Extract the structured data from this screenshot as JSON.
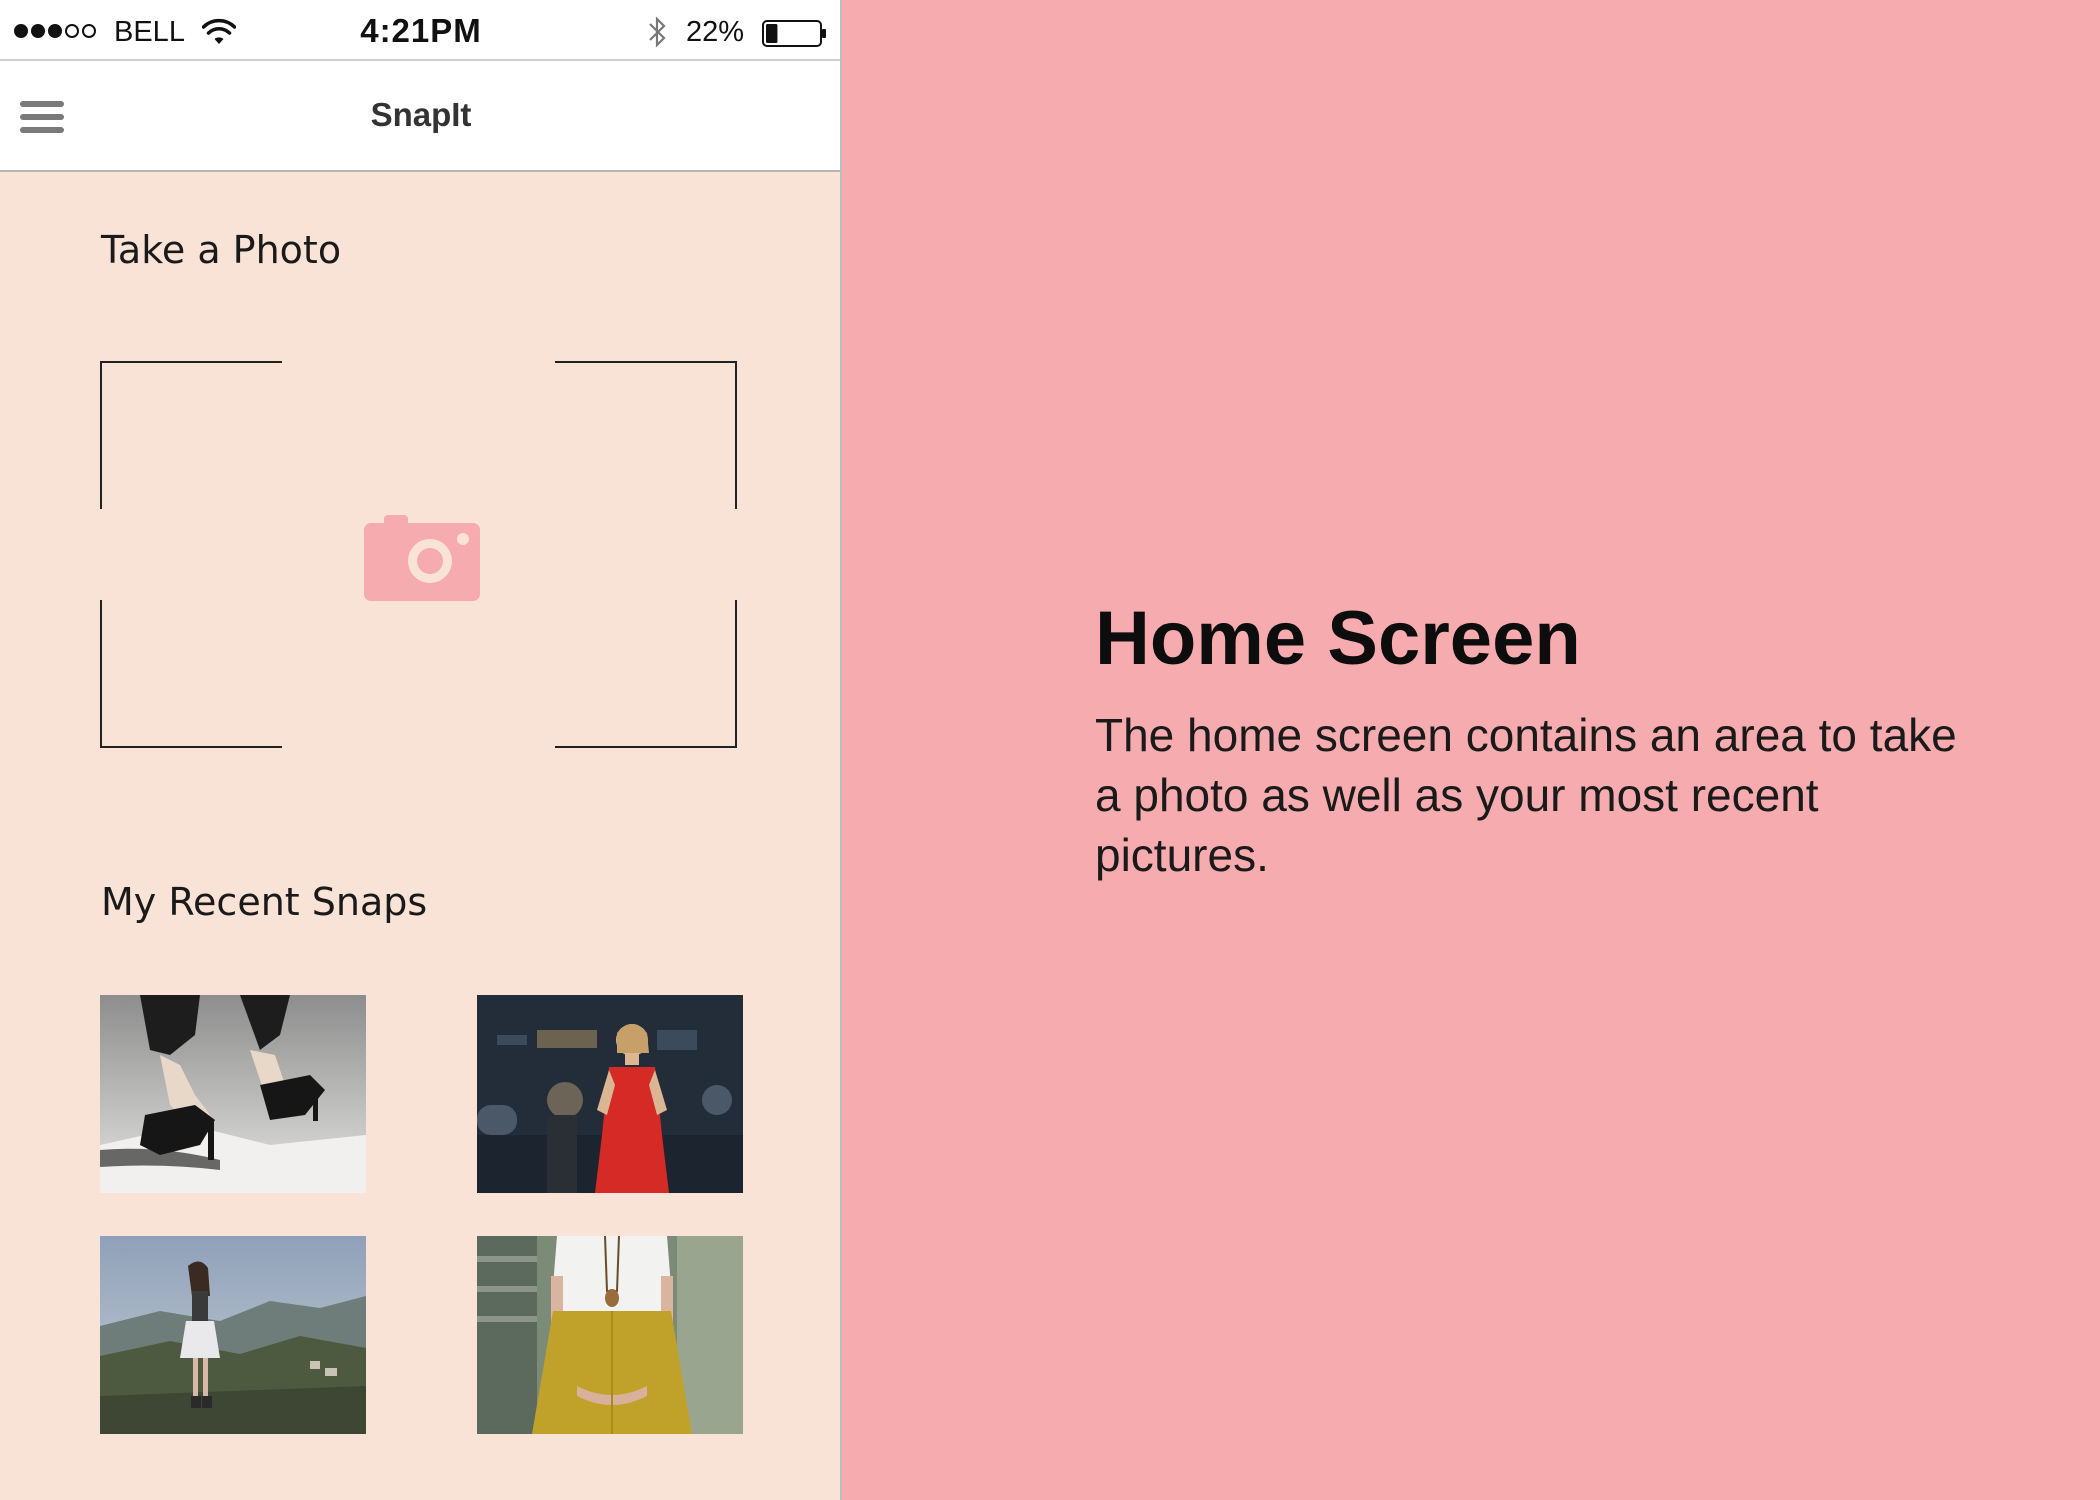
{
  "status_bar": {
    "signal_dots": [
      true,
      true,
      true,
      false,
      false
    ],
    "carrier": "BELL",
    "time": "4:21PM",
    "battery_percent_label": "22%",
    "battery_level": 0.22
  },
  "app_bar": {
    "menu_icon": "hamburger-menu-icon",
    "title": "SnapIt"
  },
  "take_photo": {
    "heading": "Take a Photo",
    "icon": "camera-icon",
    "accent_color": "#f6abae"
  },
  "recent_snaps": {
    "heading": "My Recent Snaps",
    "photos": [
      {
        "subject": "high-heels"
      },
      {
        "subject": "red-dress-red-carpet"
      },
      {
        "subject": "woman-on-hilltop"
      },
      {
        "subject": "white-top-mustard-skirt"
      }
    ]
  },
  "info": {
    "title": "Home Screen",
    "body": "The home screen contains an area to take a photo as well as your most recent pictures."
  },
  "colors": {
    "panel_background": "#f6abae",
    "phone_background": "#f9e3d7"
  }
}
